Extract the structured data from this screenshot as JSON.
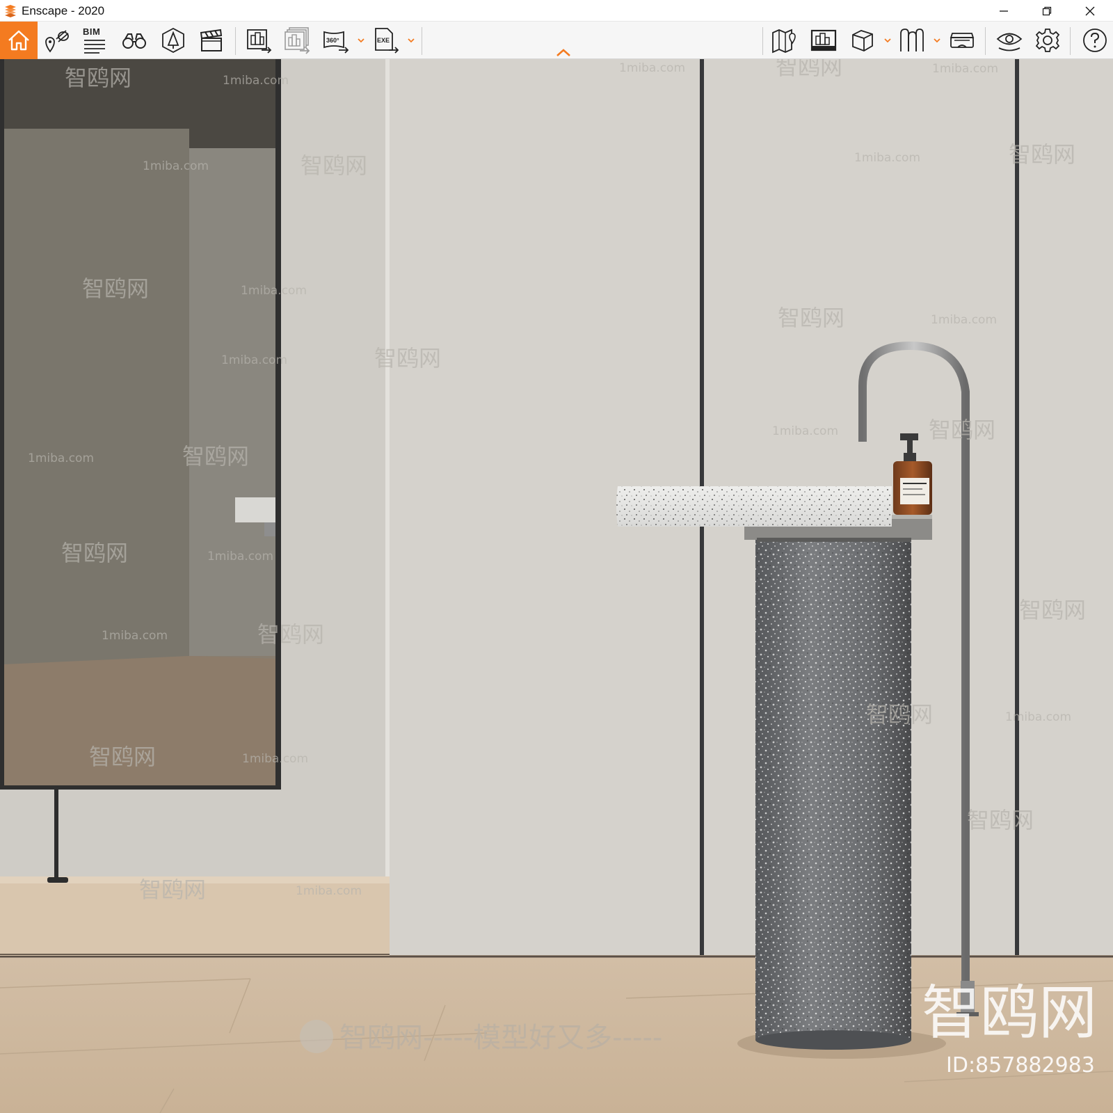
{
  "window": {
    "title": "Enscape - 2020",
    "minimize_icon": "minimize-icon",
    "restore_icon": "restore-icon",
    "close_icon": "close-icon"
  },
  "toolbar": {
    "accent_color": "#f47b20",
    "bim_label": "BIM",
    "left_tools": [
      {
        "name": "home",
        "icon": "home-icon"
      },
      {
        "name": "views",
        "icon": "view-pin-icon"
      },
      {
        "name": "bim-info",
        "icon": "bim-list-icon"
      },
      {
        "name": "walk-mode",
        "icon": "binoculars-icon"
      },
      {
        "name": "assets",
        "icon": "asset-library-icon"
      },
      {
        "name": "video-editor",
        "icon": "clapper-icon"
      },
      {
        "name": "render-image",
        "icon": "render-image-icon"
      },
      {
        "name": "batch-render",
        "icon": "batch-render-icon"
      },
      {
        "name": "panorama",
        "icon": "panorama-360-icon",
        "label": "360°"
      },
      {
        "name": "export-exe",
        "icon": "export-exe-icon",
        "label": "EXE"
      }
    ],
    "right_tools": [
      {
        "name": "map",
        "icon": "map-pin-icon"
      },
      {
        "name": "screenshot-gallery",
        "icon": "gallery-icon"
      },
      {
        "name": "cube-view",
        "icon": "cube-icon"
      },
      {
        "name": "library",
        "icon": "library-icon"
      },
      {
        "name": "vr-headset",
        "icon": "vr-headset-icon"
      },
      {
        "name": "visual-settings",
        "icon": "eye-icon"
      },
      {
        "name": "settings",
        "icon": "gear-icon"
      },
      {
        "name": "help",
        "icon": "help-icon"
      }
    ],
    "collapse_icon": "chevron-up-icon"
  },
  "viewport": {
    "watermark_site": "1miba.com",
    "watermark_brand": "智鸥网",
    "watermark_bottom_line": "智鸥网-----模型好又多-----",
    "watermark_logo": "智鸥网",
    "watermark_id": "ID:857882983"
  }
}
